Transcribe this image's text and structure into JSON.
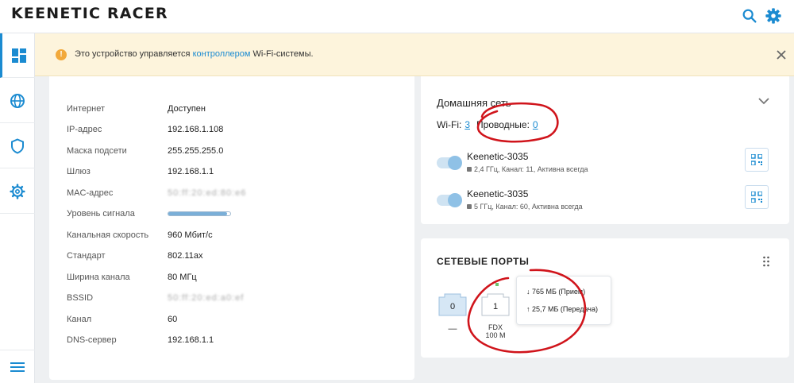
{
  "app": {
    "logo": "KEENETIC RACER"
  },
  "header": {
    "search_icon": "search-icon",
    "settings_icon": "gear-icon"
  },
  "sidebar": {
    "items": [
      {
        "icon": "dashboard-icon"
      },
      {
        "icon": "globe-icon"
      },
      {
        "icon": "shield-icon"
      },
      {
        "icon": "gear-icon"
      }
    ],
    "menu_icon": "hamburger-menu-icon"
  },
  "notice": {
    "prefix": "Это устройство управляется ",
    "link": "контроллером",
    "suffix": " Wi-Fi-системы.",
    "close": "×"
  },
  "connection": {
    "rows": [
      {
        "label": "Интернет",
        "value": "Доступен"
      },
      {
        "label": "IP-адрес",
        "value": "192.168.1.108"
      },
      {
        "label": "Маска подсети",
        "value": "255.255.255.0"
      },
      {
        "label": "Шлюз",
        "value": "192.168.1.1"
      },
      {
        "label": "MAC-адрес",
        "value": "50:ff:20:ed:80:e6"
      },
      {
        "label": "Уровень сигнала",
        "signal_percent": 95
      },
      {
        "label": "Канальная скорость",
        "value": "960 Мбит/с"
      },
      {
        "label": "Стандарт",
        "value": "802.11ax"
      },
      {
        "label": "Ширина канала",
        "value": "80 МГц"
      },
      {
        "label": "BSSID",
        "value": "50:ff:20:ed:a0:ef"
      },
      {
        "label": "Канал",
        "value": "60"
      },
      {
        "label": "DNS-сервер",
        "value": "192.168.1.1"
      }
    ]
  },
  "home_network": {
    "title": "Домашняя сеть",
    "wifi_label": "Wi-Fi:",
    "wifi_count": "3",
    "wired_label": "Проводные:",
    "wired_count": "0",
    "networks": [
      {
        "ssid": "Keenetic-3035",
        "meta": "2,4 ГГц, Канал: 11, Активна всегда"
      },
      {
        "ssid": "Keenetic-3035",
        "meta": "5 ГГц, Канал: 60, Активна всегда"
      }
    ]
  },
  "ports": {
    "title": "СЕТЕВЫЕ ПОРТЫ",
    "items": [
      {
        "num": "0",
        "status": "—"
      },
      {
        "num": "1",
        "status_line1": "FDX",
        "status_line2": "100 M"
      }
    ],
    "tooltip": {
      "rx": "↓ 765 МБ (Прием)",
      "tx": "↑ 25,7 МБ (Передача)"
    }
  },
  "colors": {
    "accent": "#1b8bd1",
    "notice_bg": "#fdf4dc",
    "annotation": "#d0141b"
  }
}
